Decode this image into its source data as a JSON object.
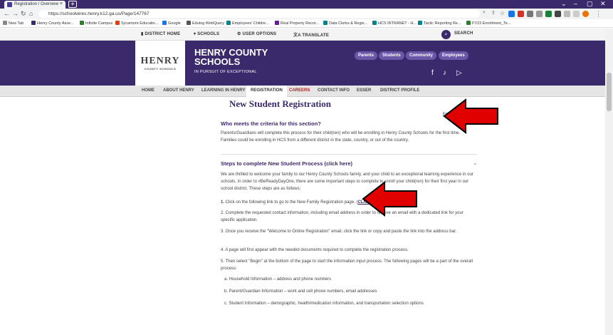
{
  "browser": {
    "tab_title": "Registration / Overview",
    "url": "https://schoolwires.henry.k12.ga.us/Page/147767",
    "bookmarks": [
      "New Tab",
      "Henry County Asse...",
      "Infinite Campus",
      "Sycamore Educatio...",
      "Google",
      "Edulog WebQuery",
      "Employees' Childre...",
      "Real Property Recor...",
      "Data Clerks & Regis...",
      "HCS INTRANET - H...",
      "Tactic Reporting Re...",
      "FY23 Enrollment_Te..."
    ]
  },
  "utility_nav": {
    "district_home": "DISTRICT HOME",
    "schools": "SCHOOLS",
    "user_options": "USER OPTIONS",
    "translate": "TRANSLATE",
    "search": "SEARCH"
  },
  "header": {
    "logo_text": "HENRY",
    "logo_sub": "COUNTY SCHOOLS",
    "name_line1": "HENRY COUNTY",
    "name_line2": "SCHOOLS",
    "motto": "IN PURSUIT OF EXCEPTIONAL",
    "audience_links": [
      "Parents",
      "Students",
      "Community",
      "Employees"
    ]
  },
  "main_nav": [
    "HOME",
    "ABOUT HENRY",
    "LEARNING IN HENRY",
    "REGISTRATION",
    "CAREERS",
    "CONTACT INFO",
    "ESSER",
    "DISTRICT PROFILE"
  ],
  "page": {
    "title": "New Student Registration",
    "expand_all": "Expand All",
    "section1": {
      "heading": "Who meets the criteria for this section?",
      "text": "Parents/Guardians will complete this process for their child(ren) who will be enrolling in Henry County Schools for the first time. Families could be enrolling in HCS from a different district in the state, country, or out of the country."
    },
    "section2": {
      "heading": "Steps to complete New Student Process (click here)",
      "intro": "We are thrilled to welcome your family to our Henry County Schools family, and your child to an exceptional learning experience in our schools. In order to #BeReadyDayOne, there are some important steps to complete to enroll your child(ren) for their first year in our school district. These steps are as follows:",
      "step1_prefix": "1.",
      "step1": " Click on the following link to go to the New Family Registration page. (",
      "step1_link": "CLICK HERE",
      "step1_end": ")",
      "step2": "2. Complete the requested contact information, including email address in order to receive an email with a dedicated link for your specific application.",
      "step3": "3. Once you receive the \"Welcome to Online Registration\" email, click the link or copy and paste the link into the address bar.",
      "step4": "4. A page will first appear with the needed documents required to complete the registration process.",
      "step5": "5. Then select \"Begin\" at the bottom of the page to start the information input process. The following pages will be a part of the overall process:",
      "sub_a": "a. Household Information – address and phone numbers",
      "sub_b": "b. Parent/Guardian Information – work and cell phone numbers, email addresses",
      "sub_c": "c. Student Information – demographic, health/medication information, and transportation selection options"
    }
  },
  "colors": {
    "brand_purple": "#3b2a6b",
    "arrow_red": "#e00000"
  }
}
